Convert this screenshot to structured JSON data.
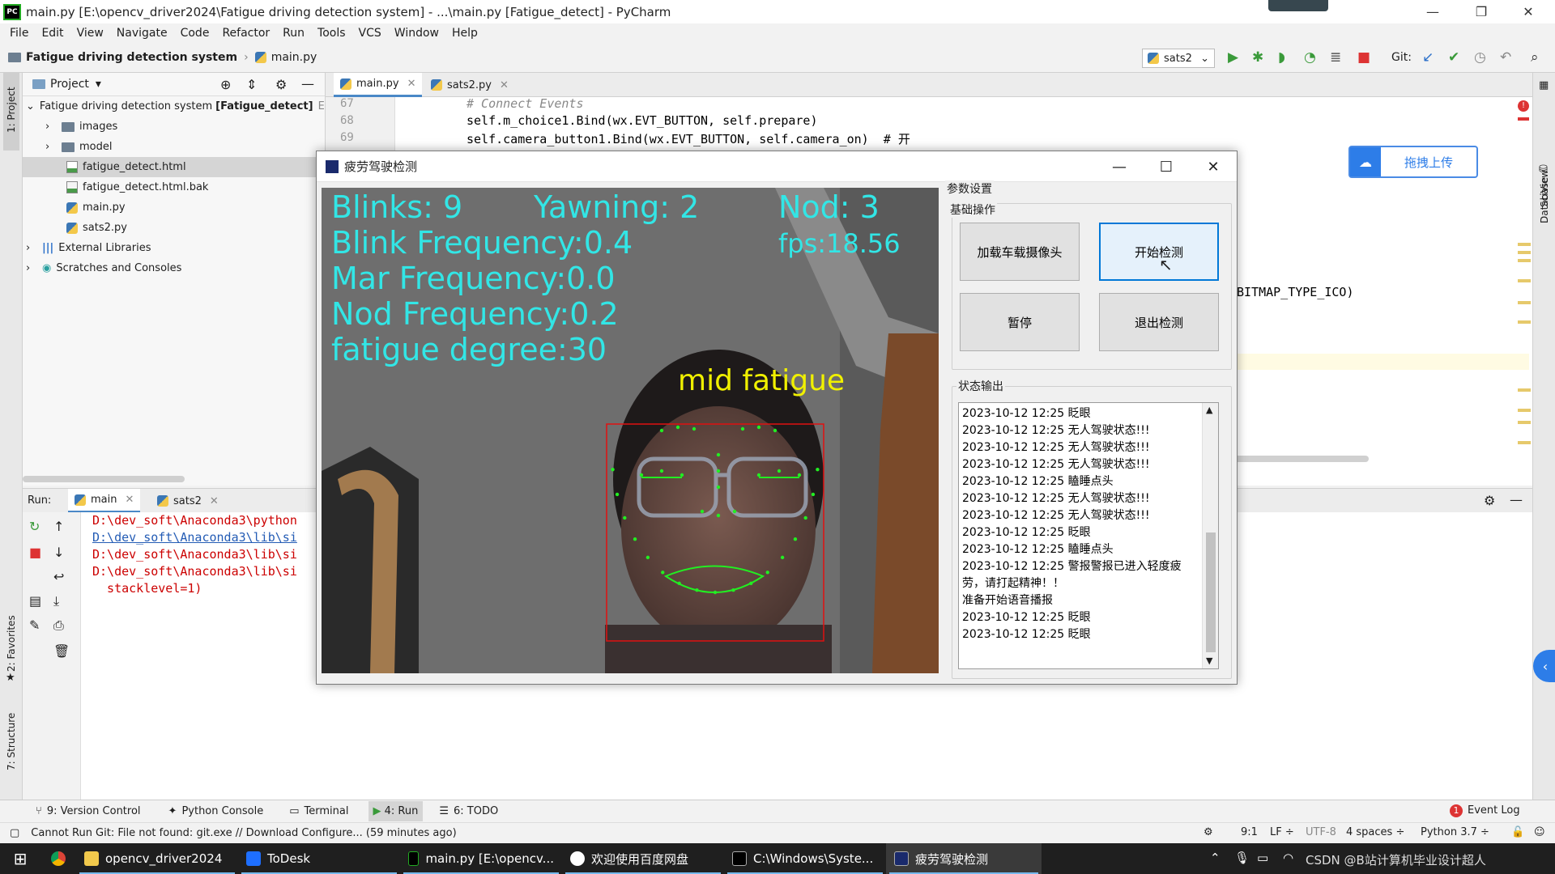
{
  "ide": {
    "window_title": "main.py [E:\\opencv_driver2024\\Fatigue driving detection system] - ...\\main.py [Fatigue_detect] - PyCharm",
    "menu": [
      "File",
      "Edit",
      "View",
      "Navigate",
      "Code",
      "Refactor",
      "Run",
      "Tools",
      "VCS",
      "Window",
      "Help"
    ],
    "breadcrumb": {
      "project": "Fatigue driving detection system",
      "file": "main.py"
    },
    "run_config": "sats2",
    "git_label": "Git:",
    "project_panel": {
      "title": "Project",
      "root": "Fatigue driving detection system",
      "root_module": "[Fatigue_detect]",
      "root_path": "E:",
      "items": [
        {
          "name": "images",
          "kind": "folder"
        },
        {
          "name": "model",
          "kind": "folder"
        },
        {
          "name": "fatigue_detect.html",
          "kind": "html"
        },
        {
          "name": "fatigue_detect.html.bak",
          "kind": "file"
        },
        {
          "name": "main.py",
          "kind": "py"
        },
        {
          "name": "sats2.py",
          "kind": "py"
        }
      ],
      "external": "External Libraries",
      "scratches": "Scratches and Consoles"
    },
    "editor_tabs": [
      "main.py",
      "sats2.py"
    ],
    "code_lines": [
      {
        "n": "67",
        "text": "# Connect Events"
      },
      {
        "n": "68",
        "text": "self.m_choice1.Bind(wx.EVT_BUTTON, self.prepare)"
      },
      {
        "n": "69",
        "text": "self.camera_button1.Bind(wx.EVT_BUTTON, self.camera_on)  # 开"
      }
    ],
    "code_partial": "BITMAP_TYPE_ICO)",
    "run": {
      "label": "Run:",
      "tabs": [
        "main",
        "sats2"
      ],
      "lines": [
        "D:\\dev_soft\\Anaconda3\\python",
        "D:\\dev_soft\\Anaconda3\\lib\\si",
        "D:\\dev_soft\\Anaconda3\\lib\\si",
        "D:\\dev_soft\\Anaconda3\\lib\\si",
        "  stacklevel=1)"
      ]
    },
    "left_strip": [
      "1: Project",
      "2: Favorites",
      "7: Structure"
    ],
    "right_strip": [
      "SciView",
      "Database"
    ],
    "bottom_tabs": [
      "9: Version Control",
      "Python Console",
      "Terminal",
      "4: Run",
      "6: TODO"
    ],
    "event_log": "Event Log",
    "event_count": "1",
    "status_msg": "Cannot Run Git: File not found: git.exe // Download Configure... (59 minutes ago)",
    "status_right": [
      "9:1",
      "LF ÷",
      "UTF-8",
      "4 spaces ÷",
      "Python 3.7 ÷"
    ]
  },
  "upload": {
    "label": "拖拽上传"
  },
  "app": {
    "title": "疲劳驾驶检测",
    "params_group": "参数设置",
    "basic_group": "基础操作",
    "buttons": [
      "加载车载摄像头",
      "开始检测",
      "暂停",
      "退出检测"
    ],
    "status_group": "状态输出",
    "log": [
      "2023-10-12 12:25 眨眼",
      "2023-10-12 12:25 无人驾驶状态!!!",
      "2023-10-12 12:25 无人驾驶状态!!!",
      "2023-10-12 12:25 无人驾驶状态!!!",
      "2023-10-12 12:25 瞌睡点头",
      "2023-10-12 12:25 无人驾驶状态!!!",
      "2023-10-12 12:25 无人驾驶状态!!!",
      "2023-10-12 12:25 眨眼",
      "2023-10-12 12:25 瞌睡点头",
      "2023-10-12 12:25 警报警报已进入轻度疲",
      "劳，请打起精神！！",
      "准备开始语音播报",
      "2023-10-12 12:25 眨眼",
      "2023-10-12 12:25 眨眼"
    ],
    "overlay": {
      "blinks": "Blinks: 9",
      "yawning": "Yawning: 2",
      "nod": "Nod: 3",
      "blink_freq": "Blink Frequency:0.4",
      "fps": "fps:18.56",
      "mar_freq": "Mar Frequency:0.0",
      "nod_freq": "Nod Frequency:0.2",
      "fatigue_degree": "fatigue degree:30",
      "state": "mid fatigue"
    }
  },
  "taskbar": {
    "items": [
      "opencv_driver2024",
      "ToDesk",
      "main.py [E:\\opencv...",
      "欢迎使用百度网盘",
      "C:\\Windows\\Syste...",
      "疲劳驾驶检测"
    ],
    "tray_text": "CSDN @B站计算机毕业设计超人"
  },
  "colors": {
    "accent": "#0078d7",
    "overlay_cyan": "#32e6e6",
    "overlay_yellow": "#f0f000",
    "landmark_green": "#22ee22",
    "bbox_red": "#e01010"
  }
}
